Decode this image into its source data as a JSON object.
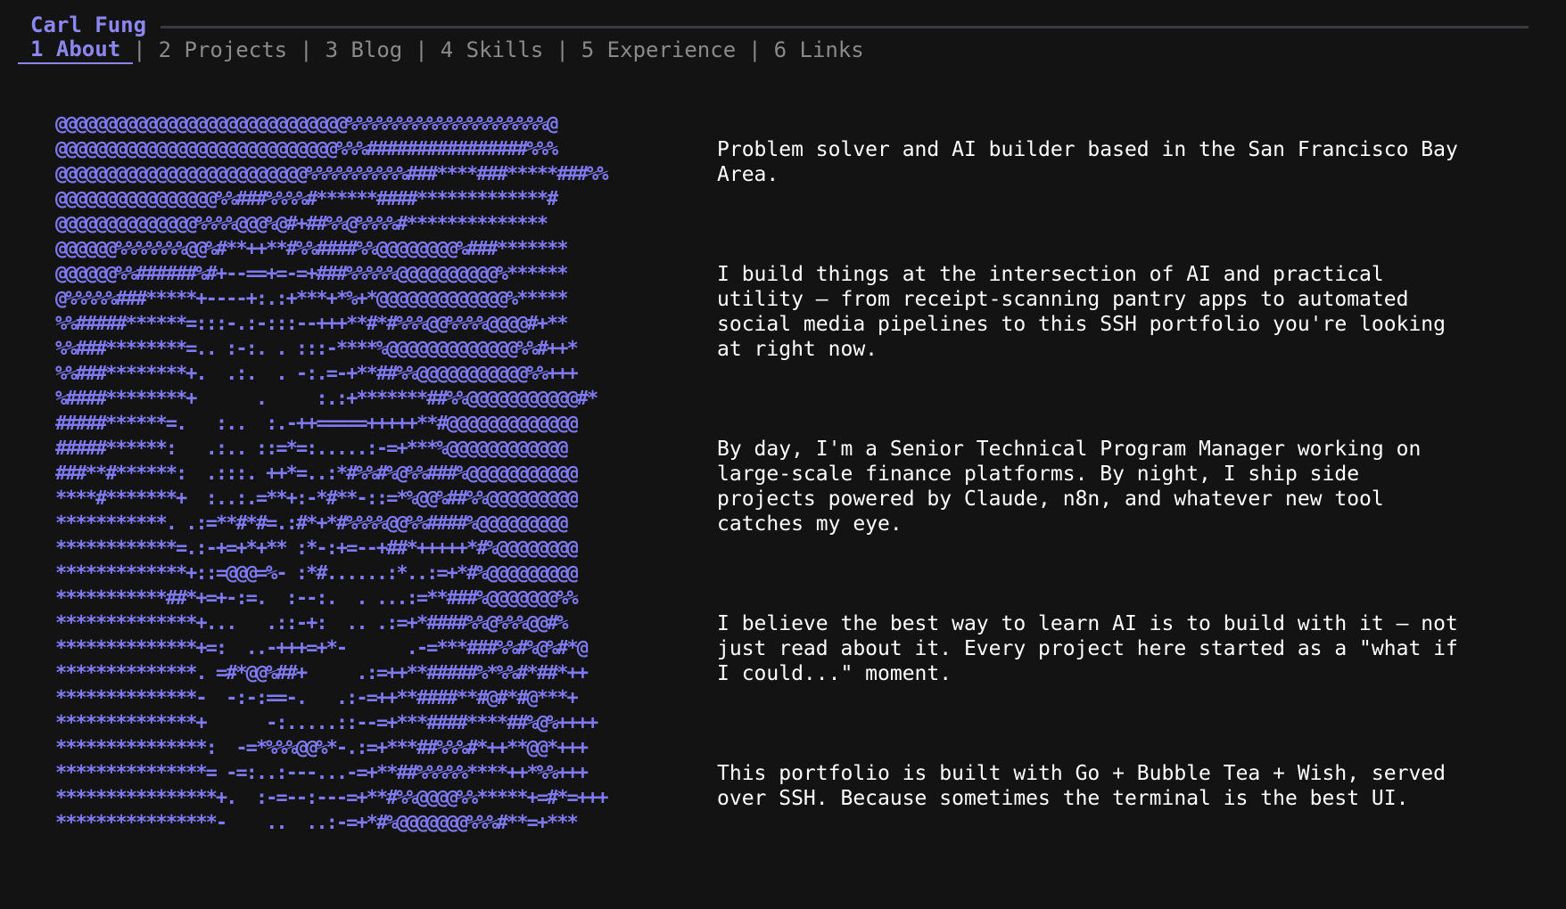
{
  "header": {
    "title": "Carl Fung"
  },
  "nav": {
    "tabs": [
      {
        "label": "1 About"
      },
      {
        "label": "2 Projects"
      },
      {
        "label": "3 Blog"
      },
      {
        "label": "4 Skills"
      },
      {
        "label": "5 Experience"
      },
      {
        "label": "6 Links"
      }
    ],
    "separator": "|"
  },
  "portrait": {
    "ascii": "@@@@@@@@@@@@@@@@@@@@@@@@@@@@@%%%%%%%%%%%%%%%%%%%%@\n@@@@@@@@@@@@@@@@@@@@@@@@@@@@%%%################%%%\n@@@@@@@@@@@@@@@@@@@@@@@@@%%%%%%%%%%###****###*****###%%\n@@@@@@@@@@@@@@@@%%###%%%%#******####*************#\n@@@@@@@@@@@@@@%%%%@@@%@#+##%%@%%%%#**************\n@@@@@@%%%%%%%@@%#**++**#%%####%%@@@@@@@@%###*******\n@@@@@@%%######%#+--==+=-=+###%%%%%@@@@@@@@@@%******\n@%%%%%###*****+----+:.:+***+*%+*@@@@@@@@@@@@@%*****\n%%#####******=:::-.:-:::--+++**#*#%%%@@%%%%@@@@#+**\n%%###********=.. :-:. . :::-****%@@@@@@@@@@@@@%%#++*\n%%###********+.  .:.  . -:.=-+**##%%@@@@@@@@@@@%%+++\n%####********+      .     :.:+*******##%%@@@@@@@@@@@#*\n#####******=.   :..  :.-++=====+++++**#@@@@@@@@@@@@@\n#####******:   .:.. ::=*=:.....:-=+***%@@@@@@@@@@@@\n###**#******:  .:::. ++*=..:*#%%#%@%%###%@@@@@@@@@@@\n****#*******+  :..:.=**+:-*#**-::=*%@@%##%%@@@@@@@@@\n***********. .:=**#*#=.:#*+*#%%%%@@%%####%@@@@@@@@@\n************=.:-+=+*+** :*-:+=--+##*+++++*#%@@@@@@@@\n*************+::=@@@=%- :*#......:*..:=+*#%@@@@@@@@@\n***********##*+=+-:=.  :--:.  . ...:=**###%@@@@@@@%%\n**************+...   .::-+:  .. .:=+*####%%@%%%@@#%\n**************+=:  ..-+++=+*-      .-=***###%%#%@%#*@\n**************. =#*@@%##+     .:=++**#####%*%%#*##*++\n**************-  -:-:==-.   .:-=++**####**#@#*#@***+\n**************+      -:.....::--=+***####****##%@%++++\n***************:  -=*%%%@@%*-.:=+***##%%%#*++**@@*+++\n***************= -=:..:---...-=+**##%%%%%****++*%%+++\n****************+.  :-=--:---=+**#%%@@@@%%*****+=#*=+++\n****************-    ..  ..:-=+*#%@@@@@@@%%%#**=+***"
  },
  "about": {
    "paragraphs": [
      "Problem solver and AI builder based in the San Francisco Bay\nArea.",
      "I build things at the intersection of AI and practical\nutility — from receipt-scanning pantry apps to automated\nsocial media pipelines to this SSH portfolio you're looking\nat right now.",
      "By day, I'm a Senior Technical Program Manager working on\nlarge-scale finance platforms. By night, I ship side\nprojects powered by Claude, n8n, and whatever new tool\ncatches my eye.",
      "I believe the best way to learn AI is to build with it — not\njust read about it. Every project here started as a \"what if\nI could...\" moment.",
      "This portfolio is built with Go + Bubble Tea + Wish, served\nover SSH. Because sometimes the terminal is the best UI."
    ]
  },
  "colors": {
    "accent": "#8c86f0",
    "ascii": "#7f7af3",
    "inactive": "#8a8a8a",
    "background": "#131313",
    "text": "#ffffff"
  }
}
